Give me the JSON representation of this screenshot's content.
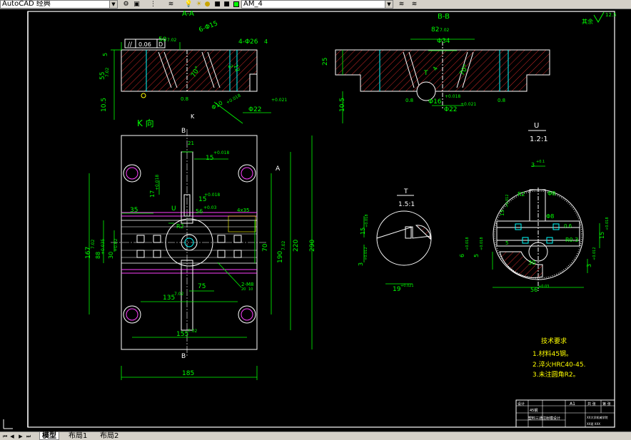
{
  "toolbar": {
    "workspace": "AutoCAD 经典",
    "layer": "AM_4",
    "colors": {
      "layer_swatch": "#00ff00"
    }
  },
  "drawing": {
    "section_aa": {
      "title": "A-A",
      "flatness_symbol": "//",
      "flatness_value": "0.06",
      "flatness_datum": "D",
      "dims": [
        "50",
        "7.02",
        "6-Φ15",
        "4-Φ26",
        "4",
        "5",
        "55",
        "7.02",
        "10.5",
        "70°",
        "2",
        "12",
        "0.8",
        "Φ10",
        "+0.018",
        "Φ22",
        "+0.021"
      ]
    },
    "section_bb": {
      "title": "B-B",
      "dims": [
        "82",
        "7.02",
        "Φ34",
        "T",
        "70°",
        "4",
        "25",
        "10.5",
        "0.8",
        "Φ16",
        "+0.018",
        "Φ22",
        "+0.021",
        "0.8"
      ]
    },
    "top_right_label": "其余",
    "top_right_value": "12.5",
    "view_k": {
      "title": "K 向",
      "label_k": "K",
      "label_b_top": "B",
      "label_b_bottom": "B",
      "label_a": "A",
      "dims": [
        "21",
        "15",
        "+0.018",
        "17",
        "+0.018",
        "15",
        "+0.018",
        "56",
        "+0.03",
        "R2",
        "4x35",
        "U",
        "35",
        "88",
        "+0.035",
        "167",
        "7.02",
        "30",
        "+0.02",
        "70",
        "190",
        "7.02",
        "220",
        "290",
        "75",
        "2-M8",
        "135",
        "7.02",
        "155",
        "7.02",
        "185",
        "20",
        "10"
      ]
    },
    "detail_t": {
      "title": "T",
      "scale": "1.5:1",
      "dims": [
        "15",
        "+0.018",
        "3",
        "+0.012",
        "19",
        "+0.021"
      ]
    },
    "detail_u": {
      "title": "U",
      "scale": "1.2:1",
      "dims": [
        "3",
        "+0.1",
        "R2",
        "Φ8",
        "Φ8",
        "0.6",
        "13",
        "+0.012",
        "5",
        "R0.3",
        "6",
        "+0.018",
        "5",
        "+0.018",
        "15",
        "+0.018",
        "30",
        "3",
        "+0.012",
        "56",
        "+0.03"
      ]
    },
    "tech_requirements": {
      "title": "技术要求",
      "items": [
        "1.材料45钢。",
        "2.淬火HRC40-45.",
        "3.未注圆角R2。"
      ]
    },
    "title_block": {
      "row1": [
        "设计",
        "",
        "A1",
        "共 张",
        "第 张"
      ],
      "material": "45钢",
      "drawing_name": "塑料三通注射模设计",
      "school": "XX大学机械学院",
      "class_name": "XX班 XXX"
    }
  },
  "layout_tabs": {
    "items": [
      "模型",
      "布局1",
      "布局2"
    ],
    "active": 0
  }
}
